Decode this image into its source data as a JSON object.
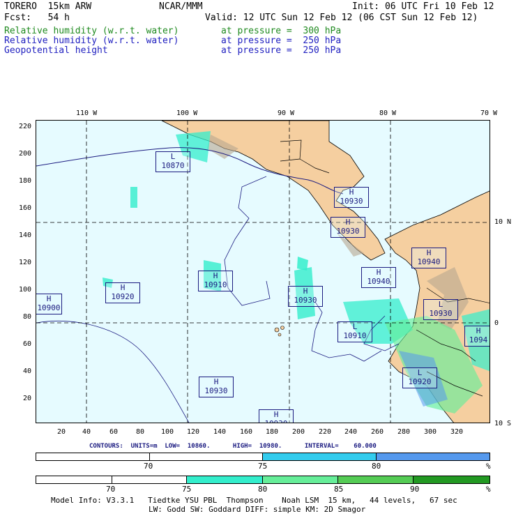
{
  "header": {
    "model": "TORERO  15km ARW",
    "org": "NCAR/MMM",
    "init": "Init: 06 UTC Fri 10 Feb 12",
    "fcst": "Fcst:   54 h",
    "valid": "Valid: 12 UTC Sun 12 Feb 12 (06 CST Sun 12 Feb 12)",
    "fields": [
      {
        "name": "Relative humidity (w.r.t. water)",
        "level": "at pressure =  300 hPa",
        "color": "#1f8a1f"
      },
      {
        "name": "Relative humidity (w.r.t. water)",
        "level": "at pressure =  250 hPa",
        "color": "#2020c0"
      },
      {
        "name": "Geopotential height",
        "level": "at pressure =  250 hPa",
        "color": "#2020c0"
      }
    ]
  },
  "map": {
    "lon_labels": [
      "110 W",
      "100 W",
      "90 W",
      "80 W",
      "70 W"
    ],
    "lat_labels": [
      "10 N",
      "0",
      "10 S"
    ],
    "y_ticks": [
      "220",
      "200",
      "180",
      "160",
      "140",
      "120",
      "100",
      "80",
      "60",
      "40",
      "20"
    ],
    "x_ticks": [
      "20",
      "40",
      "60",
      "80",
      "100",
      "120",
      "140",
      "160",
      "180",
      "200",
      "220",
      "240",
      "260",
      "280",
      "300",
      "320"
    ],
    "centers": [
      {
        "type": "L",
        "value": "10870"
      },
      {
        "type": "H",
        "value": "10930"
      },
      {
        "type": "H",
        "value": "10930"
      },
      {
        "type": "H",
        "value": "10940"
      },
      {
        "type": "H",
        "value": "10940"
      },
      {
        "type": "L",
        "value": "10930"
      },
      {
        "type": "H",
        "value": "10910"
      },
      {
        "type": "H",
        "value": "10920"
      },
      {
        "type": "H",
        "value": "10900"
      },
      {
        "type": "H",
        "value": "10930"
      },
      {
        "type": "L",
        "value": "10910"
      },
      {
        "type": "H",
        "value": "1094"
      },
      {
        "type": "L",
        "value": "10920"
      },
      {
        "type": "H",
        "value": "10930"
      },
      {
        "type": "H",
        "value": "10930"
      }
    ],
    "colors": {
      "land": "#f5cfa0",
      "ocean": "#e6fbff",
      "grid": "#000000",
      "coast": "#1a1a80"
    }
  },
  "contours_text": "CONTOURS:  UNITS=m  LOW=  10860.      HIGH=  10980.      INTERVAL=    60.000",
  "colorbar_250": {
    "ticks": [
      "70",
      "75",
      "80"
    ],
    "unit": "%",
    "colors": [
      "#ffffff",
      "#ffffff",
      "#33ccee",
      "#33ccee",
      "#5599ee"
    ]
  },
  "colorbar_300": {
    "ticks": [
      "70",
      "75",
      "80",
      "85",
      "90"
    ],
    "unit": "%",
    "colors": [
      "#ffffff",
      "#ffffff",
      "#33eecc",
      "#66ee99",
      "#55cc55",
      "#229922"
    ]
  },
  "footer": {
    "line1": "Model Info: V3.3.1   Tiedtke YSU PBL  Thompson    Noah LSM  15 km,   44 levels,   67 sec",
    "line2": "LW: Godd SW: Goddard DIFF: simple KM: 2D Smagor"
  }
}
